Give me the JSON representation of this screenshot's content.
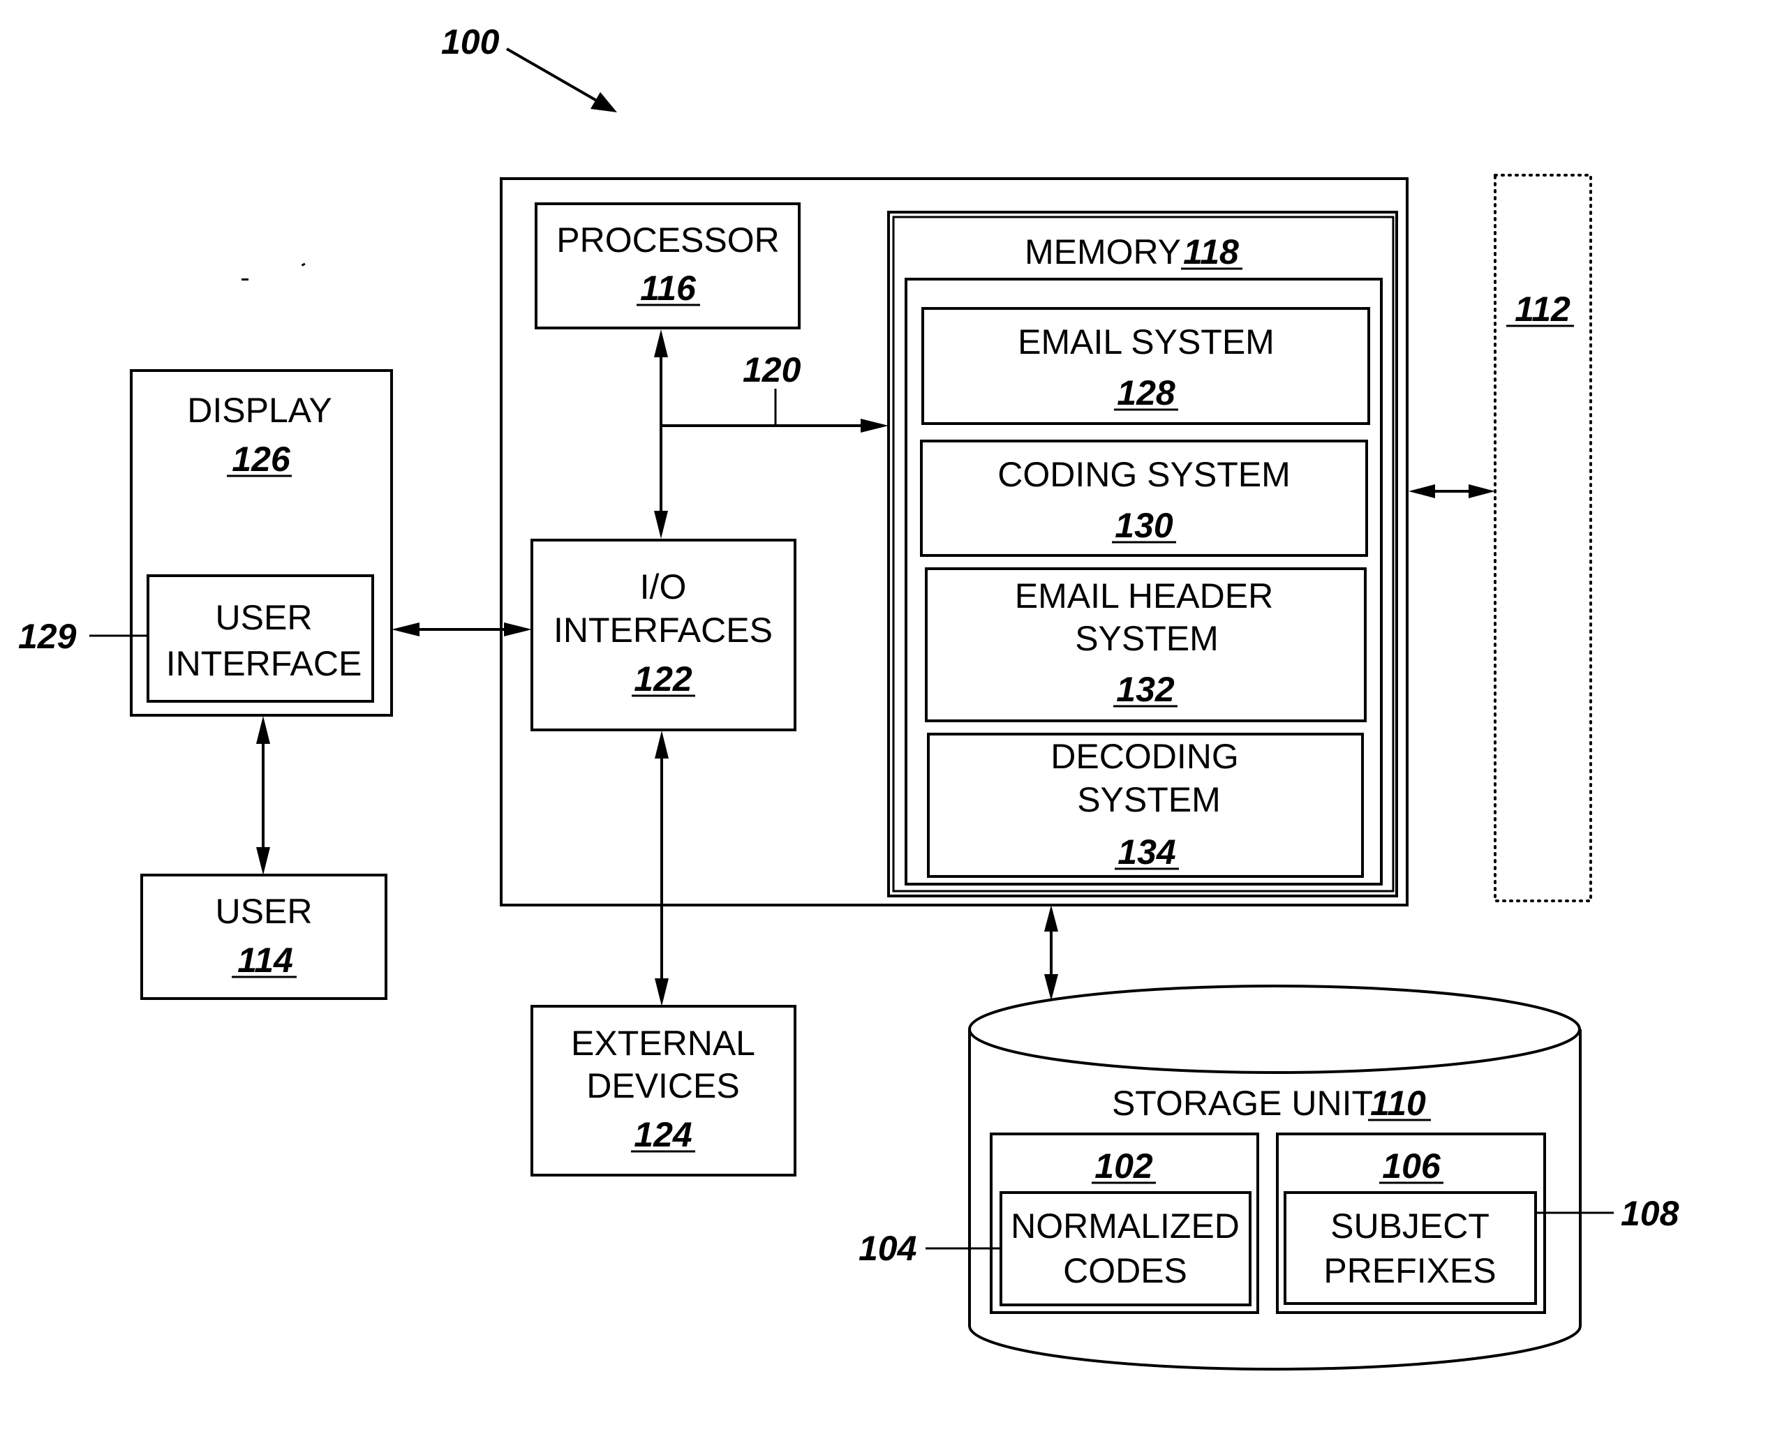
{
  "figure": {
    "reference": "100"
  },
  "computer": {
    "processor": {
      "label": "PROCESSOR",
      "ref": "116"
    },
    "bus": {
      "ref": "120"
    },
    "io": {
      "line1": "I/O",
      "line2": "INTERFACES",
      "ref": "122"
    },
    "memory": {
      "label": "MEMORY",
      "ref": "118",
      "modules": [
        {
          "line1": "EMAIL SYSTEM",
          "line2": "",
          "ref": "128"
        },
        {
          "line1": "CODING SYSTEM",
          "line2": "",
          "ref": "130"
        },
        {
          "line1": "EMAIL HEADER",
          "line2": "SYSTEM",
          "ref": "132"
        },
        {
          "line1": "DECODING",
          "line2": "SYSTEM",
          "ref": "134"
        }
      ]
    }
  },
  "display": {
    "label": "DISPLAY",
    "ref": "126"
  },
  "user_interface": {
    "line1": "USER",
    "line2": "INTERFACE",
    "ref": "129"
  },
  "user": {
    "label": "USER",
    "ref": "114"
  },
  "external": {
    "line1": "EXTERNAL",
    "line2": "DEVICES",
    "ref": "124"
  },
  "network": {
    "ref": "112"
  },
  "storage": {
    "label": "STORAGE UNIT",
    "ref": "110",
    "left_group": {
      "ref": "102",
      "inner_line1": "NORMALIZED",
      "inner_line2": "CODES",
      "inner_ref": "104"
    },
    "right_group": {
      "ref": "106",
      "inner_line1": "SUBJECT",
      "inner_line2": "PREFIXES",
      "inner_ref": "108"
    }
  }
}
